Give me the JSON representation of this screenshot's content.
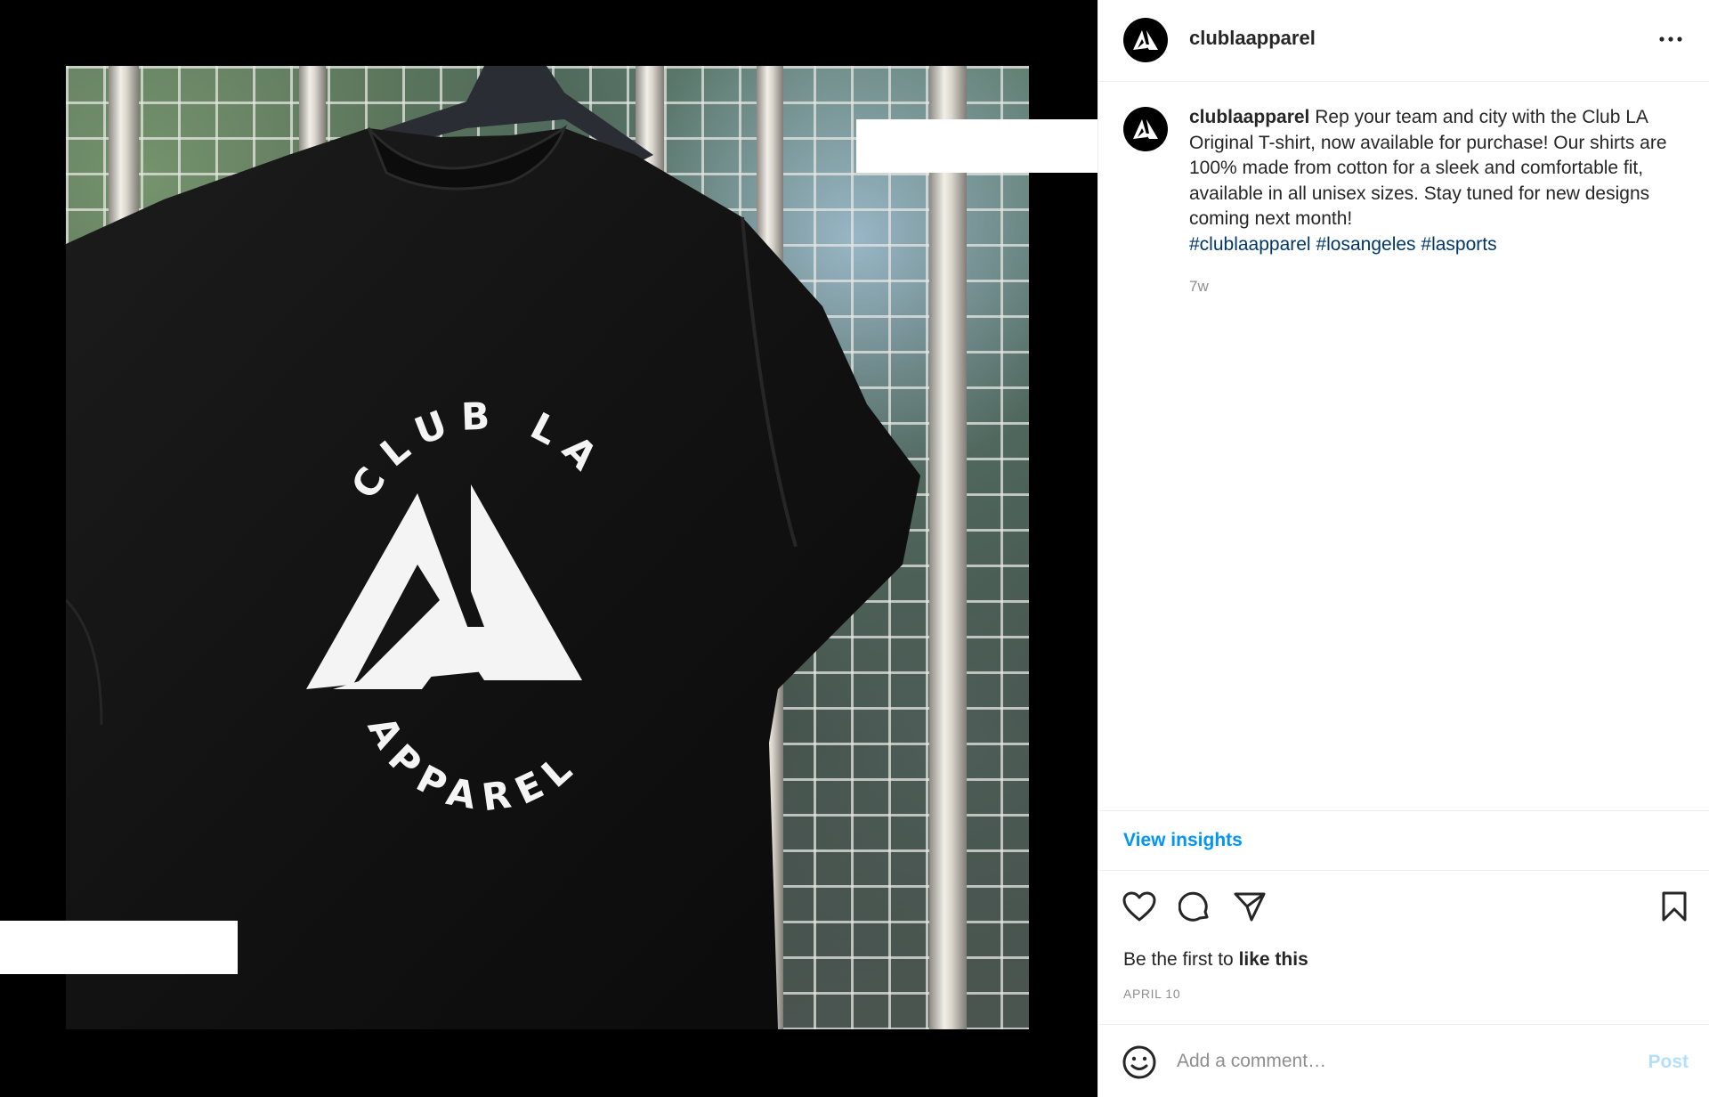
{
  "colors": {
    "link_blue": "#0095f6",
    "hashtag_blue": "#00376b",
    "post_button_disabled": "#b2dffc",
    "muted_text": "#8e8e8e",
    "text": "#262626",
    "media_background": "#000000"
  },
  "media": {
    "description_icon": "photo",
    "shirt_print": {
      "top_text": "CLUB LA",
      "bottom_text": "APPAREL"
    }
  },
  "header": {
    "avatar_icon": "club-la-logo-icon",
    "username": "clublaapparel",
    "more_icon": "more-horizontal-icon"
  },
  "caption": {
    "username": "clublaapparel",
    "text": "Rep your team and city with the Club LA Original T-shirt, now available for purchase! Our shirts are 100% made from cotton for a sleek and comfortable fit, available in all unisex sizes. Stay tuned for new designs coming next month!",
    "hashtags": [
      "#clublaapparel",
      "#losangeles",
      "#lasports"
    ],
    "age": "7w"
  },
  "insights": {
    "label": "View insights"
  },
  "actions": {
    "icons": [
      "heart-icon",
      "comment-icon",
      "share-icon",
      "bookmark-icon"
    ]
  },
  "likes": {
    "prefix": "Be the first to ",
    "emphasis": "like this"
  },
  "date": "APRIL 10",
  "comment": {
    "placeholder": "Add a comment…",
    "post_label": "Post",
    "emoji_icon": "emoji-icon"
  }
}
